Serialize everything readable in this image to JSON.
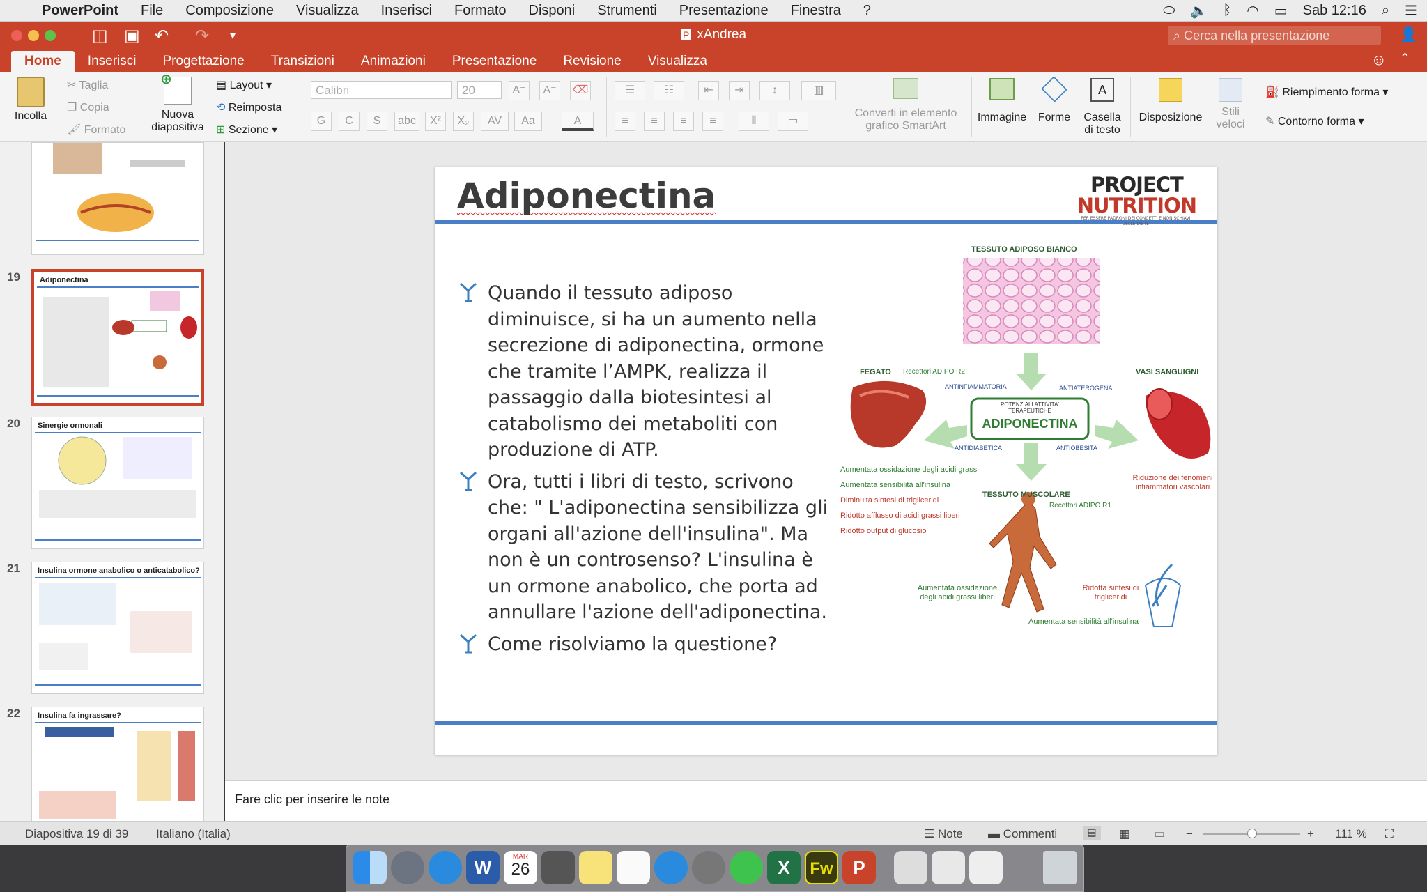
{
  "menubar": {
    "app": "PowerPoint",
    "items": [
      "File",
      "Composizione",
      "Visualizza",
      "Inserisci",
      "Formato",
      "Disponi",
      "Strumenti",
      "Presentazione",
      "Finestra",
      "?"
    ],
    "clock": "Sab 12:16"
  },
  "window": {
    "title": "xAndrea",
    "search_placeholder": "Cerca nella presentazione"
  },
  "tabs": [
    "Home",
    "Inserisci",
    "Progettazione",
    "Transizioni",
    "Animazioni",
    "Presentazione",
    "Revisione",
    "Visualizza"
  ],
  "ribbon": {
    "paste": "Incolla",
    "cut": "Taglia",
    "copy": "Copia",
    "format": "Formato",
    "new_slide": "Nuova diapositiva",
    "layout": "Layout",
    "reset": "Reimposta",
    "section": "Sezione",
    "font": "Calibri",
    "size": "20",
    "bold": "G",
    "italic": "C",
    "underline": "S",
    "strike": "abc",
    "superscript": "X²",
    "subscript": "X₂",
    "smartart": "Converti in elemento grafico SmartArt",
    "image": "Immagine",
    "shapes": "Forme",
    "textbox": "Casella di testo",
    "arrange": "Disposizione",
    "quick_styles": "Stili veloci",
    "shape_fill": "Riempimento forma",
    "shape_outline": "Contorno forma"
  },
  "thumbs": [
    {
      "num": "",
      "title": ""
    },
    {
      "num": "19",
      "title": "Adiponectina"
    },
    {
      "num": "20",
      "title": "Sinergie ormonali"
    },
    {
      "num": "21",
      "title": "Insulina ormone anabolico o anticatabolico?"
    },
    {
      "num": "22",
      "title": "Insulina fa ingrassare?"
    }
  ],
  "slide": {
    "title": "Adiponectina",
    "logo_line1": "PROJECT",
    "logo_line2": "NUTRITION",
    "logo_tag": "PER ESSERE PADRONI DEI CONCETTI E NON SCHIAVI DELLE DIETE",
    "bullets": [
      "Quando il tessuto adiposo diminuisce, si ha un aumento nella secrezione di adiponectina, ormone che tramite l’AMPK, realizza il passaggio dalla biotesintesi al catabolismo dei metaboliti con produzione di ATP.",
      "Ora, tutti i libri di testo, scrivono che: \" L'adiponectina sensibilizza gli organi all'azione dell'insulina\". Ma non è un controsenso? L'insulina è un ormone anabolico, che porta ad annullare l'azione dell'adiponectina.",
      "Come risolviamo la questione?"
    ],
    "diagram": {
      "tissue": "TESSUTO ADIPOSO BIANCO",
      "liver": "FEGATO",
      "liver_rec": "Recettori ADIPO R2",
      "vessels": "VASI SANGUIGNI",
      "muscle": "TESSUTO MUSCOLARE",
      "muscle_rec": "Recettori ADIPO R1",
      "center_small": "POTENZIALI ATTIVITA' TERAPEUTICHE",
      "center": "ADIPONECTINA",
      "anti1": "ANTINFIAMMATORIA",
      "anti2": "ANTIATEROGENA",
      "anti3": "ANTIDIABETICA",
      "anti4": "ANTIOBESITA",
      "liver_effects": [
        "Aumentata ossidazione degli acidi grassi",
        "Aumentata sensibilità all'insulina",
        "Diminuita sintesi di trigliceridi",
        "Ridotto afflusso di acidi grassi liberi",
        "Ridotto output di glucosio"
      ],
      "vessel_effect": "Riduzione dei fenomeni infiammatori vascolari",
      "muscle_effect1": "Aumentata ossidazione degli acidi grassi liberi",
      "muscle_effect2": "Ridotta sintesi di trigliceridi",
      "muscle_effect3": "Aumentata sensibilità all'insulina"
    }
  },
  "notes_placeholder": "Fare clic per inserire le note",
  "status": {
    "slide": "Diapositiva 19 di 39",
    "lang": "Italiano (Italia)",
    "notes": "Note",
    "comments": "Commenti",
    "zoom": "111 %"
  },
  "dock": {
    "calendar_month": "MAR",
    "calendar_day": "26"
  },
  "colors": {
    "accent": "#c9432a",
    "slide_blue": "#4a7fc8"
  }
}
